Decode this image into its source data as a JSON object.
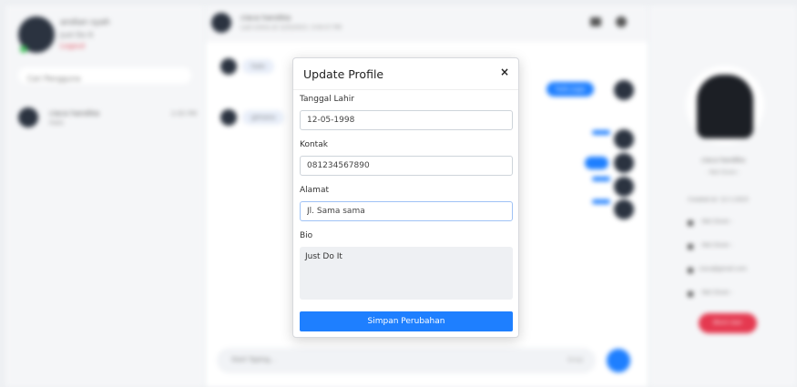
{
  "sidebar": {
    "user_name": "andian syah",
    "user_status": "Just Do It",
    "logout_label": "Logout",
    "search_placeholder": "Cari Pengguna",
    "contacts": [
      {
        "name": "ciaca handika",
        "last_message": "Halo",
        "time": "2:05 PM"
      }
    ]
  },
  "chat": {
    "contact_name": "ciaca handika",
    "last_seen": "Last online at 12/5/2023, 3:04:57 PM",
    "incoming": [
      "halo",
      "gimana"
    ],
    "outgoing": [
      "halo juga"
    ],
    "input_placeholder": "Start Typing...",
    "emoji_label": "Emoji"
  },
  "profile_panel": {
    "name": "ciaca handika",
    "subtitle": "- Not Given -",
    "joined": "Created at: 12-1-2023",
    "lines": [
      "- Not Given -",
      "- Not Given -",
      "ciaca@gmail.com",
      "- Not Given -"
    ],
    "block_label": "Block User"
  },
  "modal": {
    "title": "Update Profile",
    "close_glyph": "×",
    "fields": {
      "birthdate": {
        "label": "Tanggal Lahir",
        "value": "12-05-1998"
      },
      "contact": {
        "label": "Kontak",
        "value": "081234567890"
      },
      "address": {
        "label": "Alamat",
        "value": "Jl. Sama sama"
      },
      "bio": {
        "label": "Bio",
        "value": "Just Do It"
      }
    },
    "save_label": "Simpan Perubahan"
  },
  "colors": {
    "accent": "#1e7fff",
    "danger": "#e53950",
    "online": "#3fbf5a"
  }
}
